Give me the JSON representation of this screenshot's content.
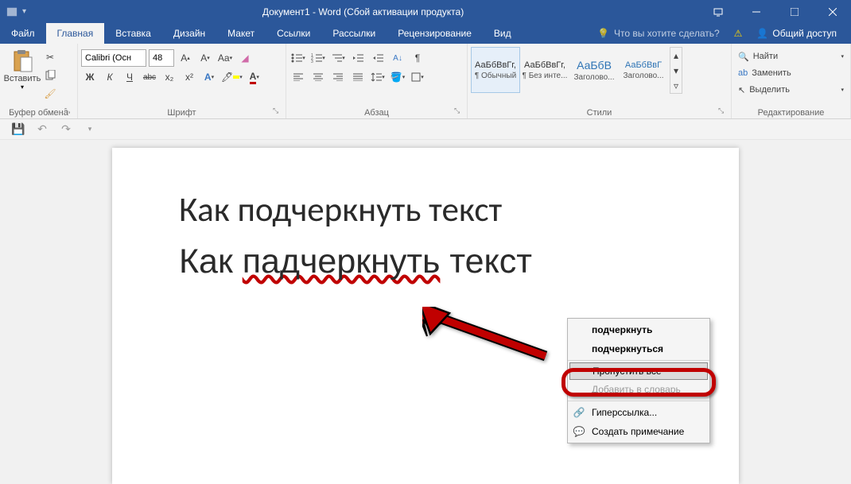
{
  "title_bar": {
    "title": "Документ1 - Word (Сбой активации продукта)"
  },
  "menu": {
    "file": "Файл",
    "home": "Главная",
    "insert": "Вставка",
    "design": "Дизайн",
    "layout": "Макет",
    "references": "Ссылки",
    "mailings": "Рассылки",
    "review": "Рецензирование",
    "view": "Вид",
    "tell_me": "Что вы хотите сделать?",
    "share": "Общий доступ"
  },
  "ribbon": {
    "clipboard": {
      "label": "Буфер обмена",
      "paste": "Вставить"
    },
    "font": {
      "label": "Шрифт",
      "name": "Calibri (Осн",
      "size": "48",
      "bold": "Ж",
      "italic": "К",
      "underline": "Ч",
      "strike": "abc",
      "sub": "x₂",
      "sup": "x²"
    },
    "paragraph": {
      "label": "Абзац"
    },
    "styles": {
      "label": "Стили",
      "items": [
        {
          "preview": "АаБбВвГг,",
          "name": "¶ Обычный"
        },
        {
          "preview": "АаБбВвГг,",
          "name": "¶ Без инте..."
        },
        {
          "preview": "АаБбВ",
          "name": "Заголово..."
        },
        {
          "preview": "АаБбВвГ",
          "name": "Заголово..."
        }
      ]
    },
    "editing": {
      "label": "Редактирование",
      "find": "Найти",
      "replace": "Заменить",
      "select": "Выделить"
    }
  },
  "document": {
    "line1": "Как подчеркнуть текст",
    "line2_pre": "Как ",
    "line2_err": "падчеркнуть",
    "line2_post": " текст"
  },
  "context_menu": {
    "suggest1": "подчеркнуть",
    "suggest2": "подчеркнуться",
    "ignore_all": "Пропустить все",
    "add_dict": "Добавить в словарь",
    "hyperlink": "Гиперссылка...",
    "new_comment": "Создать примечание"
  }
}
